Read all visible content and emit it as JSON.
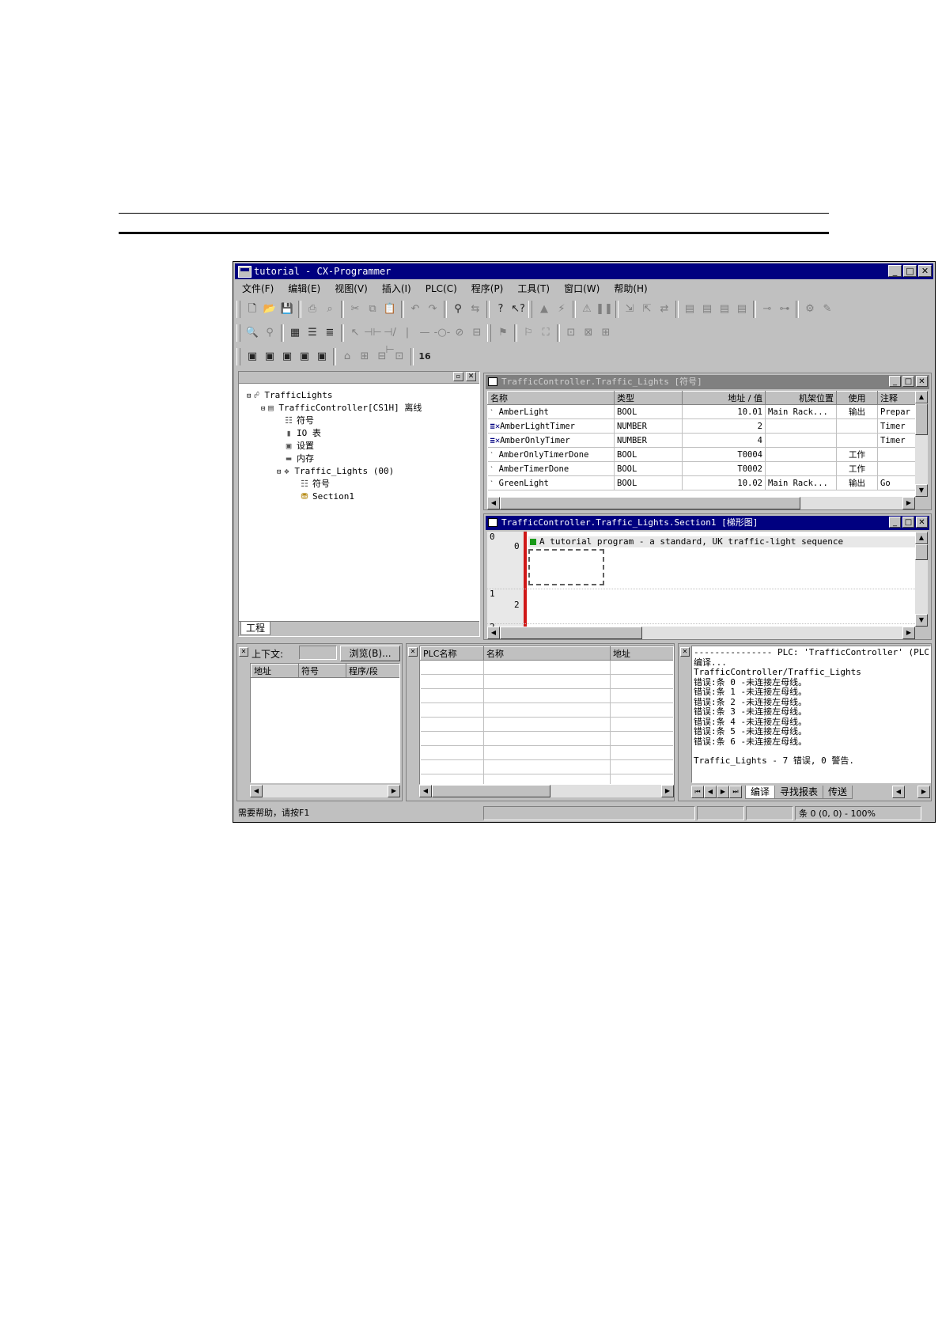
{
  "window": {
    "title": "tutorial - CX-Programmer"
  },
  "menu": [
    "文件(F)",
    "编辑(E)",
    "视图(V)",
    "插入(I)",
    "PLC(C)",
    "程序(P)",
    "工具(T)",
    "窗口(W)",
    "帮助(H)"
  ],
  "project_tree": {
    "tab_label": "工程",
    "nodes": [
      {
        "label": "TrafficLights",
        "icon": "network-icon"
      },
      {
        "label": "TrafficController[CS1H] 离线",
        "icon": "plc-icon"
      },
      {
        "label": "符号",
        "icon": "symbols-icon"
      },
      {
        "label": "IO 表",
        "icon": "io-table-icon"
      },
      {
        "label": "设置",
        "icon": "settings-icon"
      },
      {
        "label": "内存",
        "icon": "memory-icon"
      },
      {
        "label": "Traffic_Lights (00)",
        "icon": "program-icon"
      },
      {
        "label": "符号",
        "icon": "symbols-icon"
      },
      {
        "label": "Section1",
        "icon": "section-icon"
      }
    ]
  },
  "symbols_window": {
    "title": "TrafficController.Traffic_Lights [符号]",
    "columns": [
      "名称",
      "类型",
      "地址 / 值",
      "机架位置",
      "使用",
      "注释"
    ],
    "rows": [
      {
        "name": "AmberLight",
        "type": "BOOL",
        "address": "10.01",
        "rack": "Main Rack...",
        "usage": "输出",
        "comment": "Prepar"
      },
      {
        "name": "AmberLightTimer",
        "type": "NUMBER",
        "address": "2",
        "rack": "",
        "usage": "",
        "comment": "Timer"
      },
      {
        "name": "AmberOnlyTimer",
        "type": "NUMBER",
        "address": "4",
        "rack": "",
        "usage": "",
        "comment": "Timer"
      },
      {
        "name": "AmberOnlyTimerDone",
        "type": "BOOL",
        "address": "T0004",
        "rack": "",
        "usage": "工作",
        "comment": ""
      },
      {
        "name": "AmberTimerDone",
        "type": "BOOL",
        "address": "T0002",
        "rack": "",
        "usage": "工作",
        "comment": ""
      },
      {
        "name": "GreenLight",
        "type": "BOOL",
        "address": "10.02",
        "rack": "Main Rack...",
        "usage": "输出",
        "comment": "Go"
      }
    ]
  },
  "ladder_window": {
    "title": "TrafficController.Traffic_Lights.Section1 [梯形图]",
    "rungs": [
      {
        "rung": "0",
        "step": "0",
        "comment": "A tutorial program - a standard, UK traffic-light sequence"
      },
      {
        "rung": "1",
        "step": "2",
        "comment": ""
      },
      {
        "rung": "2",
        "step": "",
        "comment": ""
      }
    ]
  },
  "watch_pane": {
    "context_label": "上下文:",
    "browse_label": "浏览(B)...",
    "columns": [
      "地址",
      "符号",
      "程序/段"
    ]
  },
  "address_pane": {
    "columns": [
      "PLC名称",
      "名称",
      "地址"
    ]
  },
  "output_pane": {
    "lines": [
      "--------------- PLC: 'TrafficController' (PLC",
      "编译...",
      "TrafficController/Traffic_Lights",
      "错误:条 0 -未连接左母线。",
      "错误:条 1 -未连接左母线。",
      "错误:条 2 -未连接左母线。",
      "错误:条 3 -未连接左母线。",
      "错误:条 4 -未连接左母线。",
      "错误:条 5 -未连接左母线。",
      "错误:条 6 -未连接左母线。",
      "",
      "Traffic_Lights - 7 错误, 0 警告."
    ],
    "tabs": [
      "编译",
      "寻找报表",
      "传送"
    ]
  },
  "statusbar": {
    "help": "需要帮助，请按F1",
    "position": "条 0 (0, 0)  - 100%"
  }
}
